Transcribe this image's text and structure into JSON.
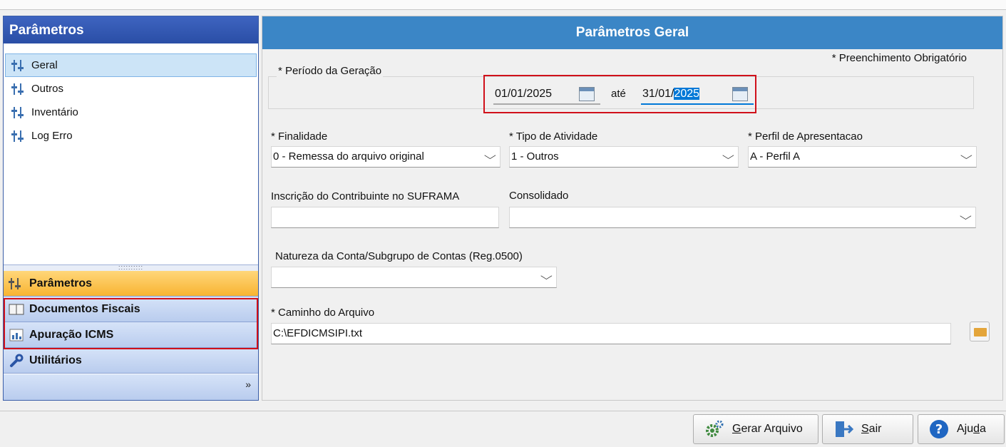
{
  "nav": {
    "title": "Parâmetros",
    "tree": [
      {
        "label": "Geral",
        "icon": "sliders-icon",
        "selected": true
      },
      {
        "label": "Outros",
        "icon": "sliders-icon"
      },
      {
        "label": "Inventário",
        "icon": "sliders-icon"
      },
      {
        "label": "Log Erro",
        "icon": "sliders-icon"
      }
    ],
    "groups": [
      {
        "label": "Parâmetros",
        "icon": "sliders-icon",
        "active": true
      },
      {
        "label": "Documentos Fiscais",
        "icon": "book-icon"
      },
      {
        "label": "Apuração ICMS",
        "icon": "chart-icon"
      },
      {
        "label": "Utilitários",
        "icon": "wrench-icon"
      }
    ],
    "footer_chevron": "»"
  },
  "content": {
    "title": "Parâmetros Geral",
    "required_note": "* Preenchimento Obrigatório",
    "period_label": "* Período da Geração",
    "date_from": "01/01/2025",
    "until_label": "até",
    "date_to_prefix": "31/01/",
    "date_to_selected": "2025",
    "finalidade_label": "* Finalidade",
    "finalidade_value": "0 - Remessa do arquivo original",
    "tipo_label": "* Tipo de Atividade",
    "tipo_value": "1 - Outros",
    "perfil_label": "* Perfil de Apresentacao",
    "perfil_value": "A - Perfil A",
    "suframa_label": "Inscrição do Contribuinte no SUFRAMA",
    "suframa_value": "",
    "consolidado_label": "Consolidado",
    "consolidado_value": "",
    "natureza_label": "Natureza da Conta/Subgrupo de Contas (Reg.0500)",
    "natureza_value": "",
    "caminho_label": "* Caminho do Arquivo",
    "caminho_value": "C:\\EFDICMSIPI.txt"
  },
  "buttons": {
    "gerar": {
      "accel": "G",
      "rest": "erar Arquivo"
    },
    "sair": {
      "accel": "S",
      "rest": "air"
    },
    "ajuda": {
      "pre": "Aju",
      "accel": "d",
      "rest": "a"
    }
  },
  "colors": {
    "nav_header": "#2a4ea6",
    "content_header": "#3b86c6",
    "active_group": "#f8b431",
    "highlight_box": "#d0101a"
  }
}
